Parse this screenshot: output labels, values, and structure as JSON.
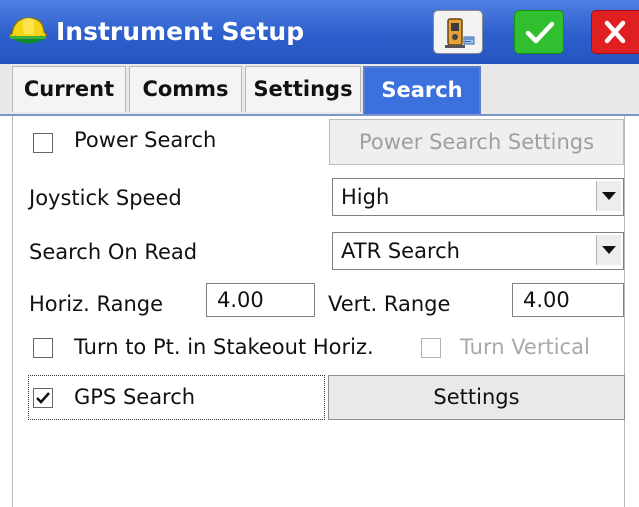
{
  "window": {
    "title": "Instrument Setup",
    "icons": {
      "app": "surveyor-hardhat-icon",
      "instrument": "total-station-icon",
      "ok": "checkmark-icon",
      "cancel": "close-x-icon"
    },
    "colors": {
      "titlebar": "#2d5fcc",
      "ok": "#2fbf2f",
      "cancel": "#e02020",
      "active_tab": "#3c70dd"
    }
  },
  "tabs": [
    {
      "label": "Current",
      "active": false
    },
    {
      "label": "Comms",
      "active": false
    },
    {
      "label": "Settings",
      "active": false
    },
    {
      "label": "Search",
      "active": true
    }
  ],
  "form": {
    "power_search": {
      "label": "Power Search",
      "checked": false
    },
    "power_search_settings_button": {
      "label": "Power Search Settings",
      "enabled": false
    },
    "joystick_speed": {
      "label": "Joystick Speed",
      "value": "High"
    },
    "search_on_read": {
      "label": "Search On Read",
      "value": "ATR Search"
    },
    "horiz_range": {
      "label": "Horiz. Range",
      "value": "4.00"
    },
    "vert_range": {
      "label": "Vert. Range",
      "value": "4.00"
    },
    "turn_to_pt": {
      "label": "Turn to Pt. in Stakeout Horiz.",
      "checked": false
    },
    "turn_vertical": {
      "label": "Turn Vertical",
      "checked": false,
      "enabled": false
    },
    "gps_search": {
      "label": "GPS Search",
      "checked": true
    },
    "settings_button": {
      "label": "Settings"
    }
  }
}
